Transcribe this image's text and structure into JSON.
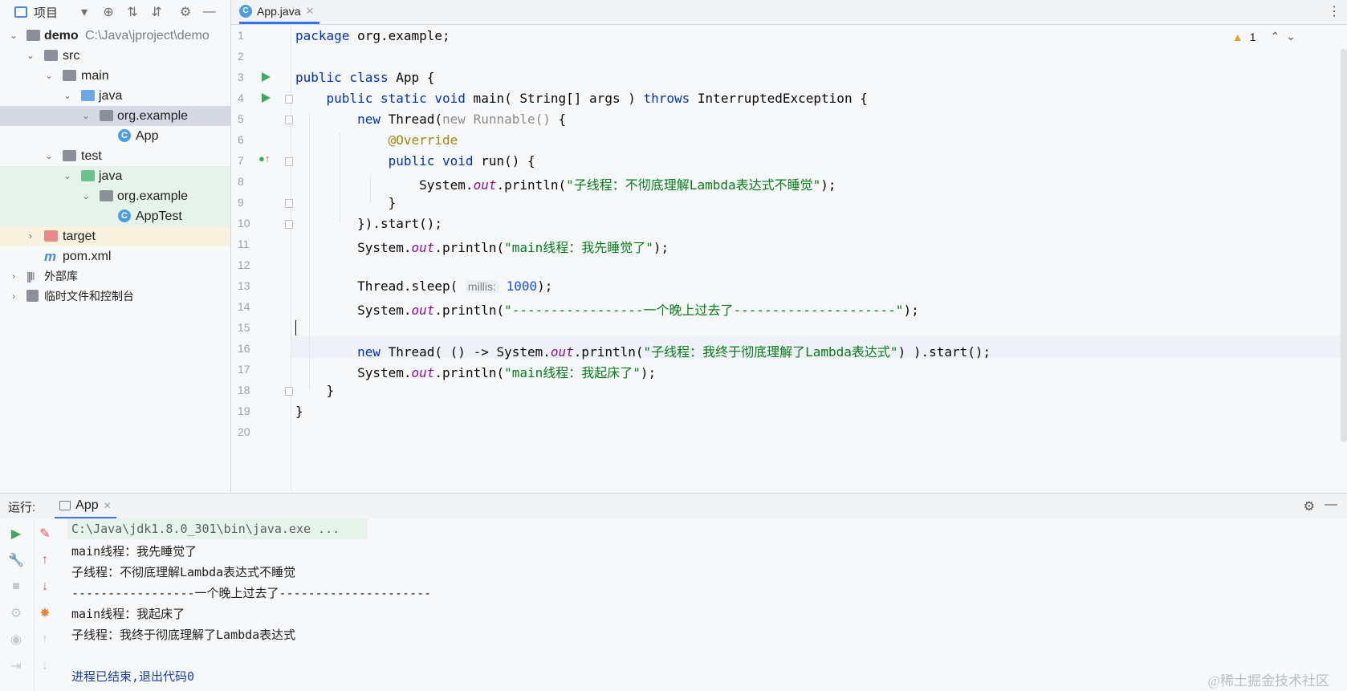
{
  "project_panel": {
    "title": "项目",
    "tree": [
      {
        "label": "demo",
        "path": "C:\\Java\\jproject\\demo"
      },
      {
        "label": "src"
      },
      {
        "label": "main"
      },
      {
        "label": "java"
      },
      {
        "label": "org.example"
      },
      {
        "label": "App"
      },
      {
        "label": "test"
      },
      {
        "label": "java"
      },
      {
        "label": "org.example"
      },
      {
        "label": "AppTest"
      },
      {
        "label": "target"
      },
      {
        "label": "pom.xml"
      },
      {
        "label": "外部库"
      },
      {
        "label": "临时文件和控制台"
      }
    ]
  },
  "editor": {
    "tab_label": "App.java",
    "warning_count": "1",
    "line_numbers": [
      "1",
      "2",
      "3",
      "4",
      "5",
      "6",
      "7",
      "8",
      "9",
      "10",
      "11",
      "12",
      "13",
      "14",
      "15",
      "16",
      "17",
      "18",
      "19",
      "20"
    ],
    "hint_millis": "millis:"
  },
  "run_panel": {
    "label": "运行:",
    "tab_label": "App",
    "output": [
      "C:\\Java\\jdk1.8.0_301\\bin\\java.exe ...",
      "main线程：我先睡觉了",
      "子线程：不彻底理解Lambda表达式不睡觉",
      "-----------------一个晚上过去了---------------------",
      "main线程：我起床了",
      "子线程：我终于彻底理解了Lambda表达式",
      "",
      "进程已结束,退出代码0"
    ]
  },
  "watermark": "@稀土掘金技术社区"
}
